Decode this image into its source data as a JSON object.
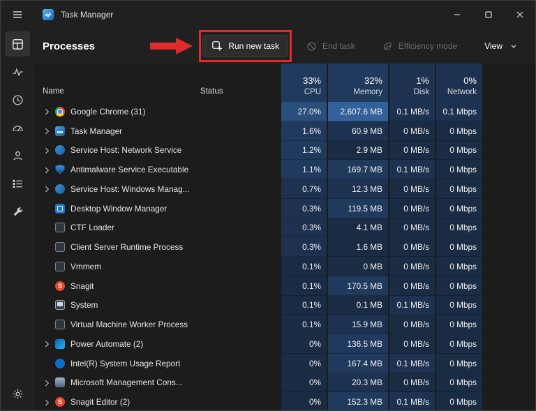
{
  "titlebar": {
    "app_title": "Task Manager"
  },
  "sidebar": {
    "items": [
      {
        "icon": "processes-icon",
        "selected": true
      },
      {
        "icon": "performance-icon",
        "selected": false
      },
      {
        "icon": "app-history-icon",
        "selected": false
      },
      {
        "icon": "startup-apps-icon",
        "selected": false
      },
      {
        "icon": "users-icon",
        "selected": false
      },
      {
        "icon": "details-icon",
        "selected": false
      },
      {
        "icon": "services-icon",
        "selected": false
      }
    ],
    "bottom_item": {
      "icon": "settings-icon"
    }
  },
  "header": {
    "title": "Processes",
    "buttons": {
      "run_new_task": "Run new task",
      "end_task": "End task",
      "efficiency_mode": "Efficiency mode",
      "view": "View"
    }
  },
  "table": {
    "columns": {
      "name": {
        "label": "Name"
      },
      "status": {
        "label": "Status"
      },
      "cpu": {
        "total": "33%",
        "label": "CPU"
      },
      "memory": {
        "total": "32%",
        "label": "Memory"
      },
      "disk": {
        "total": "1%",
        "label": "Disk"
      },
      "network": {
        "total": "0%",
        "label": "Network"
      }
    },
    "header_heat": {
      "cpu": 2,
      "memory": 2,
      "disk": 1,
      "network": 1
    },
    "rows": [
      {
        "name": "Google Chrome (31)",
        "icon": "chrome",
        "expandable": true,
        "status": "",
        "cpu": "27.0%",
        "memory": "2,607.6 MB",
        "disk": "0.1 MB/s",
        "network": "0.1 Mbps",
        "heat": [
          4,
          5,
          1,
          1
        ]
      },
      {
        "name": "Task Manager",
        "icon": "taskmgr",
        "expandable": true,
        "status": "",
        "cpu": "1.6%",
        "memory": "60.9 MB",
        "disk": "0 MB/s",
        "network": "0 Mbps",
        "heat": [
          2,
          1,
          0,
          0
        ]
      },
      {
        "name": "Service Host: Network Service",
        "icon": "servicehost",
        "expandable": true,
        "status": "",
        "cpu": "1.2%",
        "memory": "2.9 MB",
        "disk": "0 MB/s",
        "network": "0 Mbps",
        "heat": [
          2,
          0,
          0,
          0
        ]
      },
      {
        "name": "Antimalware Service Executable",
        "icon": "defender",
        "expandable": true,
        "status": "",
        "cpu": "1.1%",
        "memory": "169.7 MB",
        "disk": "0.1 MB/s",
        "network": "0 Mbps",
        "heat": [
          2,
          2,
          1,
          0
        ]
      },
      {
        "name": "Service Host: Windows Manag...",
        "icon": "servicehost",
        "expandable": true,
        "status": "",
        "cpu": "0.7%",
        "memory": "12.3 MB",
        "disk": "0 MB/s",
        "network": "0 Mbps",
        "heat": [
          1,
          1,
          0,
          0
        ]
      },
      {
        "name": "Desktop Window Manager",
        "icon": "dwm",
        "expandable": false,
        "status": "",
        "cpu": "0.3%",
        "memory": "119.5 MB",
        "disk": "0 MB/s",
        "network": "0 Mbps",
        "heat": [
          1,
          2,
          0,
          0
        ]
      },
      {
        "name": "CTF Loader",
        "icon": "generic",
        "expandable": false,
        "status": "",
        "cpu": "0.3%",
        "memory": "4.1 MB",
        "disk": "0 MB/s",
        "network": "0 Mbps",
        "heat": [
          1,
          0,
          0,
          0
        ]
      },
      {
        "name": "Client Server Runtime Process",
        "icon": "generic",
        "expandable": false,
        "status": "",
        "cpu": "0.3%",
        "memory": "1.6 MB",
        "disk": "0 MB/s",
        "network": "0 Mbps",
        "heat": [
          1,
          0,
          0,
          0
        ]
      },
      {
        "name": "Vmmem",
        "icon": "generic",
        "expandable": false,
        "status": "",
        "cpu": "0.1%",
        "memory": "0 MB",
        "disk": "0 MB/s",
        "network": "0 Mbps",
        "heat": [
          0,
          0,
          0,
          0
        ]
      },
      {
        "name": "Snagit",
        "icon": "snagit",
        "expandable": false,
        "status": "",
        "cpu": "0.1%",
        "memory": "170.5 MB",
        "disk": "0 MB/s",
        "network": "0 Mbps",
        "heat": [
          0,
          2,
          0,
          0
        ]
      },
      {
        "name": "System",
        "icon": "system",
        "expandable": false,
        "status": "",
        "cpu": "0.1%",
        "memory": "0.1 MB",
        "disk": "0.1 MB/s",
        "network": "0 Mbps",
        "heat": [
          0,
          0,
          1,
          0
        ]
      },
      {
        "name": "Virtual Machine Worker Process",
        "icon": "generic",
        "expandable": false,
        "status": "",
        "cpu": "0.1%",
        "memory": "15.9 MB",
        "disk": "0 MB/s",
        "network": "0 Mbps",
        "heat": [
          0,
          1,
          0,
          0
        ]
      },
      {
        "name": "Power Automate (2)",
        "icon": "powerautomate",
        "expandable": true,
        "status": "",
        "cpu": "0%",
        "memory": "136.5 MB",
        "disk": "0 MB/s",
        "network": "0 Mbps",
        "heat": [
          0,
          2,
          0,
          0
        ]
      },
      {
        "name": "Intel(R) System Usage Report",
        "icon": "intel",
        "expandable": false,
        "status": "",
        "cpu": "0%",
        "memory": "167.4 MB",
        "disk": "0.1 MB/s",
        "network": "0 Mbps",
        "heat": [
          0,
          2,
          1,
          0
        ]
      },
      {
        "name": "Microsoft Management Cons...",
        "icon": "mmc",
        "expandable": true,
        "status": "",
        "cpu": "0%",
        "memory": "20.3 MB",
        "disk": "0 MB/s",
        "network": "0 Mbps",
        "heat": [
          0,
          1,
          0,
          0
        ]
      },
      {
        "name": "Snagit Editor (2)",
        "icon": "snagit",
        "expandable": true,
        "status": "",
        "cpu": "0%",
        "memory": "152.3 MB",
        "disk": "0.1 MB/s",
        "network": "0 Mbps",
        "heat": [
          0,
          2,
          1,
          0
        ]
      }
    ]
  },
  "colors": {
    "annotation_red": "#e02b2b",
    "heat_palette": [
      "#1a2b44",
      "#1d3250",
      "#203a5e",
      "#254468",
      "#2a4f7c",
      "#33619c"
    ]
  }
}
